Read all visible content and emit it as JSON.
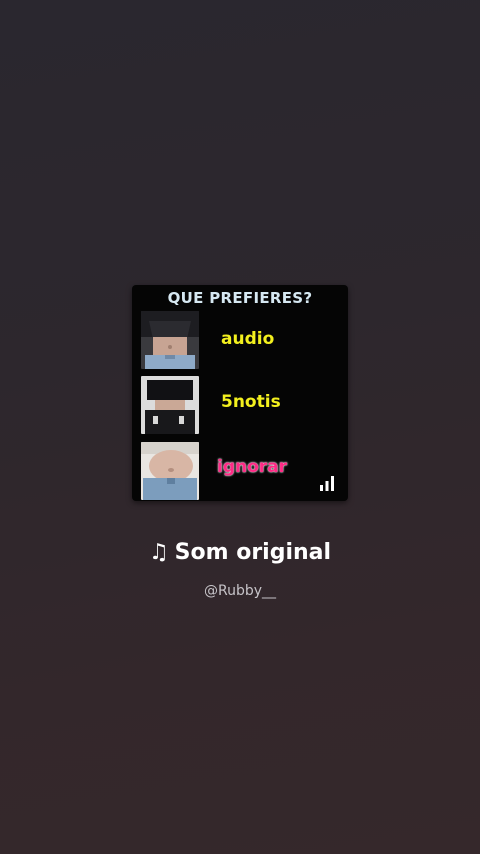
{
  "card": {
    "title": "QUE PREFIERES?",
    "options": [
      {
        "label": "audio",
        "color": "#f3f01e"
      },
      {
        "label": "5notis",
        "color": "#f3f01e"
      },
      {
        "label": "ignorar",
        "color": "#ff2b86"
      }
    ],
    "indicator_icon": "signal-bars-icon"
  },
  "song": {
    "note_icon": "♫",
    "title": "Som original",
    "author": "@Rubby__"
  }
}
